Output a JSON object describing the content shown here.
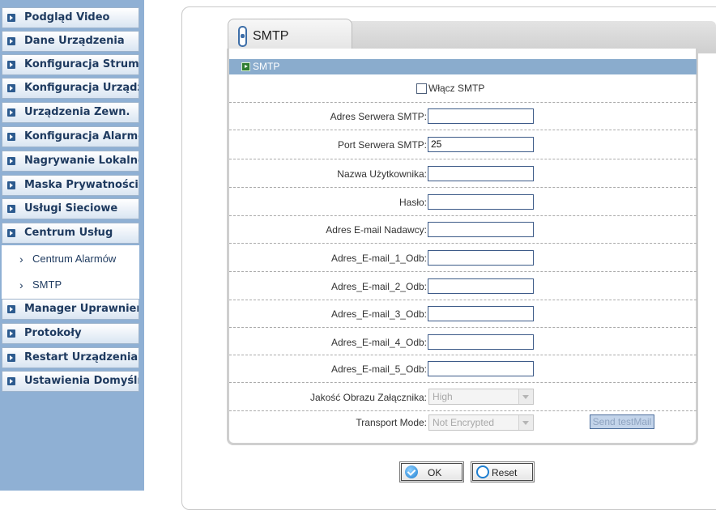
{
  "sidebar": {
    "items_top": [
      "Podgląd Video",
      "Dane Urządzenia",
      "Konfiguracja Strum.",
      "Konfiguracja Urządz.",
      "Urządzenia Zewn.",
      "Konfiguracja Alarmów",
      "Nagrywanie Lokalne",
      "Maska Prywatności",
      "Usługi Sieciowe",
      "Centrum Usług"
    ],
    "subitems": [
      "Centrum Alarmów",
      "SMTP"
    ],
    "items_bottom": [
      "Manager Uprawnień",
      "Protokoły",
      "Restart Urządzenia",
      "Ustawienia Domyślne"
    ]
  },
  "tab": {
    "title": "SMTP"
  },
  "section": {
    "title": "SMTP"
  },
  "form": {
    "enable_label": "Włącz SMTP",
    "enable_checked": false,
    "fields": [
      {
        "label": "Adres Serwera SMTP:",
        "value": ""
      },
      {
        "label": "Port Serwera SMTP:",
        "value": "25"
      },
      {
        "label": "Nazwa Użytkownika:",
        "value": ""
      },
      {
        "label": "Hasło:",
        "value": ""
      },
      {
        "label": "Adres E-mail Nadawcy:",
        "value": ""
      },
      {
        "label": "Adres_E-mail_1_Odb:",
        "value": ""
      },
      {
        "label": "Adres_E-mail_2_Odb:",
        "value": ""
      },
      {
        "label": "Adres_E-mail_3_Odb:",
        "value": ""
      },
      {
        "label": "Adres_E-mail_4_Odb:",
        "value": ""
      },
      {
        "label": "Adres_E-mail_5_Odb:",
        "value": ""
      }
    ],
    "image_quality": {
      "label": "Jakość Obrazu Załącznika:",
      "value": "High"
    },
    "transport_mode": {
      "label": "Transport Mode:",
      "value": "Not Encrypted"
    },
    "test_mail_label": "Send testMail"
  },
  "actions": {
    "ok_label": "OK",
    "reset_label": "Reset"
  },
  "colors": {
    "sidebar_bg": "#8fb0d4",
    "section_bar": "#8aaccd",
    "menu_text": "#1e3a5f"
  }
}
